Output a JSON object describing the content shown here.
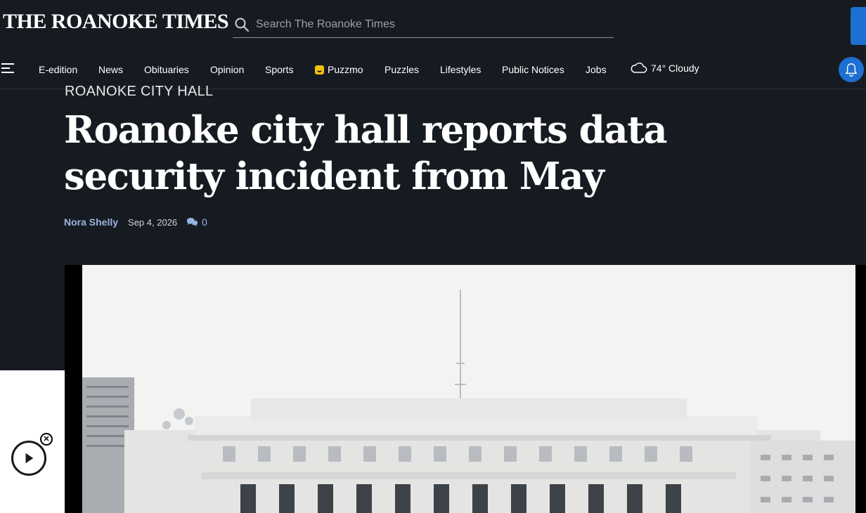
{
  "header": {
    "logo_main": "THE ROANOKE TIMES",
    "search_placeholder": "Search The Roanoke Times"
  },
  "nav": {
    "items": [
      "E-edition",
      "News",
      "Obituaries",
      "Opinion",
      "Sports",
      "Puzzmo",
      "Puzzles",
      "Lifestyles",
      "Public Notices",
      "Jobs"
    ],
    "weather": "74° Cloudy"
  },
  "article": {
    "kicker": "ROANOKE CITY HALL",
    "headline": "Roanoke city hall reports data security incident from May",
    "author": "Nora Shelly",
    "date": "Sep 4, 2026",
    "comment_count": "0"
  },
  "icons": {
    "search": "search-icon",
    "menu": "hamburger-menu-icon",
    "weather": "cloud-icon",
    "notifications": "bell-icon",
    "comments": "comments-icon",
    "video": "play-icon",
    "close": "close-icon"
  },
  "colors": {
    "background": "#161b22",
    "accent": "#1d6fd1",
    "author": "#9ab4e0"
  }
}
